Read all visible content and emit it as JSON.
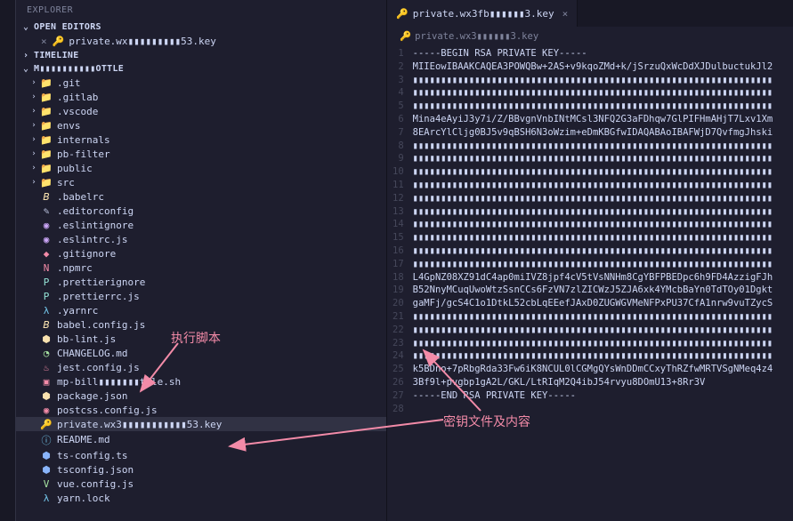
{
  "explorer": {
    "title": "EXPLORER",
    "open_editors": {
      "label": "OPEN EDITORS",
      "items": [
        {
          "icon": "🔑",
          "name": "private.wx▮▮▮▮▮▮▮▮▮53.key"
        }
      ]
    },
    "timeline": {
      "label": "TIMELINE"
    },
    "workspace": {
      "label": "M▮▮▮▮▮▮▮▮▮▮OTTLE",
      "tree": [
        {
          "depth": 1,
          "folder": true,
          "icon": "📁",
          "iconClass": "folder-icon git",
          "name": ".git"
        },
        {
          "depth": 1,
          "folder": true,
          "icon": "📁",
          "iconClass": "folder-icon git",
          "name": ".gitlab"
        },
        {
          "depth": 1,
          "folder": true,
          "icon": "📁",
          "iconClass": "folder-icon vscode",
          "name": ".vscode"
        },
        {
          "depth": 1,
          "folder": true,
          "icon": "📁",
          "iconClass": "folder-icon",
          "name": "envs"
        },
        {
          "depth": 1,
          "folder": true,
          "icon": "📁",
          "iconClass": "folder-icon",
          "name": "internals"
        },
        {
          "depth": 1,
          "folder": true,
          "icon": "📁",
          "iconClass": "folder-icon",
          "name": "pb-filter"
        },
        {
          "depth": 1,
          "folder": true,
          "icon": "📁",
          "iconClass": "folder-icon",
          "name": "public"
        },
        {
          "depth": 1,
          "folder": true,
          "icon": "📁",
          "iconClass": "folder-icon src",
          "name": "src"
        },
        {
          "depth": 1,
          "folder": false,
          "icon": "𝘉",
          "iconClass": "babel-icon",
          "name": ".babelrc"
        },
        {
          "depth": 1,
          "folder": false,
          "icon": "✎",
          "iconClass": "config-icon",
          "name": ".editorconfig"
        },
        {
          "depth": 1,
          "folder": false,
          "icon": "◉",
          "iconClass": "eslint-icon",
          "name": ".eslintignore"
        },
        {
          "depth": 1,
          "folder": false,
          "icon": "◉",
          "iconClass": "eslint-icon",
          "name": ".eslintrc.js"
        },
        {
          "depth": 1,
          "folder": false,
          "icon": "◆",
          "iconClass": "folder-icon git",
          "name": ".gitignore"
        },
        {
          "depth": 1,
          "folder": false,
          "icon": "N",
          "iconClass": "npm-icon",
          "name": ".npmrc"
        },
        {
          "depth": 1,
          "folder": false,
          "icon": "P",
          "iconClass": "prettier-icon",
          "name": ".prettierignore"
        },
        {
          "depth": 1,
          "folder": false,
          "icon": "P",
          "iconClass": "prettier-icon",
          "name": ".prettierrc.js"
        },
        {
          "depth": 1,
          "folder": false,
          "icon": "λ",
          "iconClass": "yarn-icon",
          "name": ".yarnrc"
        },
        {
          "depth": 1,
          "folder": false,
          "icon": "𝘉",
          "iconClass": "babel-icon",
          "name": "babel.config.js"
        },
        {
          "depth": 1,
          "folder": false,
          "icon": "⬢",
          "iconClass": "js-icon",
          "name": "bb-lint.js"
        },
        {
          "depth": 1,
          "folder": false,
          "icon": "◔",
          "iconClass": "changelog-icon",
          "name": "CHANGELOG.md"
        },
        {
          "depth": 1,
          "folder": false,
          "icon": "♨",
          "iconClass": "npm-icon",
          "name": "jest.config.js"
        },
        {
          "depth": 1,
          "folder": false,
          "icon": "▣",
          "iconClass": "sh-icon",
          "name": "mp-bill▮▮▮▮▮▮▮ttle.sh"
        },
        {
          "depth": 1,
          "folder": false,
          "icon": "⬢",
          "iconClass": "json-icon",
          "name": "package.json"
        },
        {
          "depth": 1,
          "folder": false,
          "icon": "◉",
          "iconClass": "npm-icon",
          "name": "postcss.config.js"
        },
        {
          "depth": 1,
          "folder": false,
          "icon": "🔑",
          "iconClass": "key-icon",
          "name": "private.wx3▮▮▮▮▮▮▮▮▮▮▮53.key",
          "selected": true
        },
        {
          "depth": 1,
          "folder": false,
          "icon": "ⓘ",
          "iconClass": "readme-icon",
          "name": "README.md"
        },
        {
          "depth": 1,
          "folder": false,
          "icon": "⬢",
          "iconClass": "ts-icon",
          "name": "ts-config.ts"
        },
        {
          "depth": 1,
          "folder": false,
          "icon": "⬢",
          "iconClass": "ts-icon",
          "name": "tsconfig.json"
        },
        {
          "depth": 1,
          "folder": false,
          "icon": "V",
          "iconClass": "changelog-icon",
          "name": "vue.config.js"
        },
        {
          "depth": 1,
          "folder": false,
          "icon": "λ",
          "iconClass": "yarn-icon",
          "name": "yarn.lock"
        }
      ]
    }
  },
  "editor": {
    "tab": {
      "icon": "🔑",
      "name": "private.wx3fb▮▮▮▮▮▮3.key"
    },
    "breadcrumb": {
      "icon": "🔑",
      "name": "private.wx3▮▮▮▮▮▮3.key"
    },
    "lines": [
      "-----BEGIN RSA PRIVATE KEY-----",
      "MIIEowIBAAKCAQEA3POWQBw+2AS+v9kqoZMd+k/jSrzuQxWcDdXJDulbuctukJl2",
      "▮▮▮▮▮▮▮▮▮▮▮▮▮▮▮▮▮▮▮▮▮▮▮▮▮▮▮▮▮▮▮▮▮▮▮▮▮▮▮▮▮▮▮▮▮▮▮▮▮▮▮▮▮▮▮▮▮▮▮▮▮▮▮▮",
      "▮▮▮▮▮▮▮▮▮▮▮▮▮▮▮▮▮▮▮▮▮▮▮▮▮▮▮▮▮▮▮▮▮▮▮▮▮▮▮▮▮▮▮▮▮▮▮▮▮▮▮▮▮▮▮▮▮▮▮▮▮▮▮▮",
      "▮▮▮▮▮▮▮▮▮▮▮▮▮▮▮▮▮▮▮▮▮▮▮▮▮▮▮▮▮▮▮▮▮▮▮▮▮▮▮▮▮▮▮▮▮▮▮▮▮▮▮▮▮▮▮▮▮▮▮▮▮▮▮▮",
      "Mina4eAyiJ3y7i/Z/BBvgnVnbINtMCsl3NFQ2G3aFDhqw7GlPIFHmAHjT7Lxv1Xm",
      "8EArcYlCljg0BJ5v9qBSH6N3oWzim+eDmKBGfwIDAQABAoIBAFWjD7QvfmgJhski",
      "▮▮▮▮▮▮▮▮▮▮▮▮▮▮▮▮▮▮▮▮▮▮▮▮▮▮▮▮▮▮▮▮▮▮▮▮▮▮▮▮▮▮▮▮▮▮▮▮▮▮▮▮▮▮▮▮▮▮▮▮▮▮▮▮",
      "▮▮▮▮▮▮▮▮▮▮▮▮▮▮▮▮▮▮▮▮▮▮▮▮▮▮▮▮▮▮▮▮▮▮▮▮▮▮▮▮▮▮▮▮▮▮▮▮▮▮▮▮▮▮▮▮▮▮▮▮▮▮▮▮",
      "▮▮▮▮▮▮▮▮▮▮▮▮▮▮▮▮▮▮▮▮▮▮▮▮▮▮▮▮▮▮▮▮▮▮▮▮▮▮▮▮▮▮▮▮▮▮▮▮▮▮▮▮▮▮▮▮▮▮▮▮▮▮▮▮",
      "▮▮▮▮▮▮▮▮▮▮▮▮▮▮▮▮▮▮▮▮▮▮▮▮▮▮▮▮▮▮▮▮▮▮▮▮▮▮▮▮▮▮▮▮▮▮▮▮▮▮▮▮▮▮▮▮▮▮▮▮▮▮▮▮",
      "▮▮▮▮▮▮▮▮▮▮▮▮▮▮▮▮▮▮▮▮▮▮▮▮▮▮▮▮▮▮▮▮▮▮▮▮▮▮▮▮▮▮▮▮▮▮▮▮▮▮▮▮▮▮▮▮▮▮▮▮▮▮▮▮",
      "▮▮▮▮▮▮▮▮▮▮▮▮▮▮▮▮▮▮▮▮▮▮▮▮▮▮▮▮▮▮▮▮▮▮▮▮▮▮▮▮▮▮▮▮▮▮▮▮▮▮▮▮▮▮▮▮▮▮▮▮▮▮▮▮",
      "▮▮▮▮▮▮▮▮▮▮▮▮▮▮▮▮▮▮▮▮▮▮▮▮▮▮▮▮▮▮▮▮▮▮▮▮▮▮▮▮▮▮▮▮▮▮▮▮▮▮▮▮▮▮▮▮▮▮▮▮▮▮▮▮",
      "▮▮▮▮▮▮▮▮▮▮▮▮▮▮▮▮▮▮▮▮▮▮▮▮▮▮▮▮▮▮▮▮▮▮▮▮▮▮▮▮▮▮▮▮▮▮▮▮▮▮▮▮▮▮▮▮▮▮▮▮▮▮▮▮",
      "▮▮▮▮▮▮▮▮▮▮▮▮▮▮▮▮▮▮▮▮▮▮▮▮▮▮▮▮▮▮▮▮▮▮▮▮▮▮▮▮▮▮▮▮▮▮▮▮▮▮▮▮▮▮▮▮▮▮▮▮▮▮▮▮",
      "▮▮▮▮▮▮▮▮▮▮▮▮▮▮▮▮▮▮▮▮▮▮▮▮▮▮▮▮▮▮▮▮▮▮▮▮▮▮▮▮▮▮▮▮▮▮▮▮▮▮▮▮▮▮▮▮▮▮▮▮▮▮▮▮",
      "L4GpNZ08XZ91dC4ap0miIVZ8jpf4cV5tVsNNHm8CgYBFPBEDpc6h9FD4AzzigFJh",
      "B52NnyMCuqUwoWtzSsnCCs6FzVN7zlZICWzJ5ZJA6xk4YMcbBaYn0TdTOy01Dgkt",
      "gaMFj/gcS4C1o1DtkL52cbLqEEefJAxD0ZUGWGVMeNFPxPU37CfA1nrw9vuTZycS",
      "▮▮▮▮▮▮▮▮▮▮▮▮▮▮▮▮▮▮▮▮▮▮▮▮▮▮▮▮▮▮▮▮▮▮▮▮▮▮▮▮▮▮▮▮▮▮▮▮▮▮▮▮▮▮▮▮▮▮▮▮▮▮▮▮",
      "▮▮▮▮▮▮▮▮▮▮▮▮▮▮▮▮▮▮▮▮▮▮▮▮▮▮▮▮▮▮▮▮▮▮▮▮▮▮▮▮▮▮▮▮▮▮▮▮▮▮▮▮▮▮▮▮▮▮▮▮▮▮▮▮",
      "▮▮▮▮▮▮▮▮▮▮▮▮▮▮▮▮▮▮▮▮▮▮▮▮▮▮▮▮▮▮▮▮▮▮▮▮▮▮▮▮▮▮▮▮▮▮▮▮▮▮▮▮▮▮▮▮▮▮▮▮▮▮▮▮",
      "▮▮▮▮▮▮▮▮▮▮▮▮▮▮▮▮▮▮▮▮▮▮▮▮▮▮▮▮▮▮▮▮▮▮▮▮▮▮▮▮▮▮▮▮▮▮▮▮▮▮▮▮▮▮▮▮▮▮▮▮▮▮▮▮",
      "k5BDno+7pRbgRda33Fw6iK8NCUL0lCGMgQYsWnDDmCCxyThRZfwMRTVSgNMeq4z4",
      "3Bf9l+pvgbp1gA2L/GKL/LtRIqM2Q4ibJ54rvyu8DOmU13+8Rr3V",
      "-----END RSA PRIVATE KEY-----",
      ""
    ]
  },
  "annotations": {
    "left": "执行脚本",
    "right": "密钥文件及内容"
  }
}
